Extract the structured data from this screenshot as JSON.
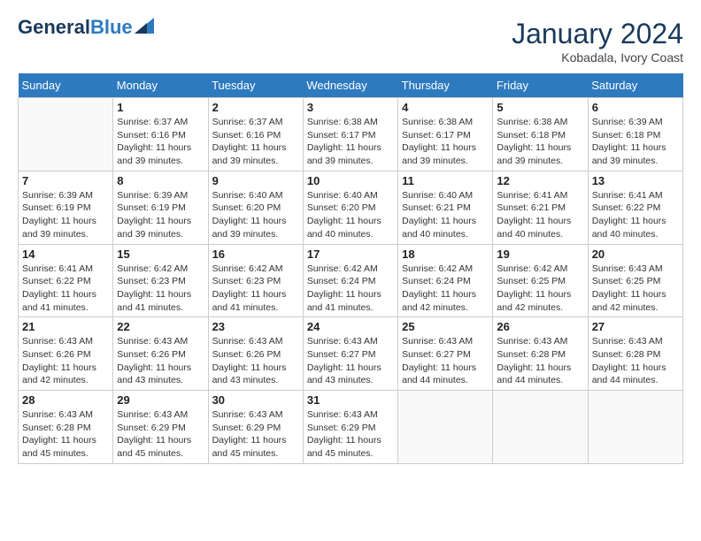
{
  "logo": {
    "general": "General",
    "blue": "Blue"
  },
  "title": {
    "month_year": "January 2024",
    "location": "Kobadala, Ivory Coast"
  },
  "days_of_week": [
    "Sunday",
    "Monday",
    "Tuesday",
    "Wednesday",
    "Thursday",
    "Friday",
    "Saturday"
  ],
  "weeks": [
    [
      {
        "day": "",
        "sunrise": "",
        "sunset": "",
        "daylight": ""
      },
      {
        "day": "1",
        "sunrise": "Sunrise: 6:37 AM",
        "sunset": "Sunset: 6:16 PM",
        "daylight": "Daylight: 11 hours and 39 minutes."
      },
      {
        "day": "2",
        "sunrise": "Sunrise: 6:37 AM",
        "sunset": "Sunset: 6:16 PM",
        "daylight": "Daylight: 11 hours and 39 minutes."
      },
      {
        "day": "3",
        "sunrise": "Sunrise: 6:38 AM",
        "sunset": "Sunset: 6:17 PM",
        "daylight": "Daylight: 11 hours and 39 minutes."
      },
      {
        "day": "4",
        "sunrise": "Sunrise: 6:38 AM",
        "sunset": "Sunset: 6:17 PM",
        "daylight": "Daylight: 11 hours and 39 minutes."
      },
      {
        "day": "5",
        "sunrise": "Sunrise: 6:38 AM",
        "sunset": "Sunset: 6:18 PM",
        "daylight": "Daylight: 11 hours and 39 minutes."
      },
      {
        "day": "6",
        "sunrise": "Sunrise: 6:39 AM",
        "sunset": "Sunset: 6:18 PM",
        "daylight": "Daylight: 11 hours and 39 minutes."
      }
    ],
    [
      {
        "day": "7",
        "sunrise": "Sunrise: 6:39 AM",
        "sunset": "Sunset: 6:19 PM",
        "daylight": "Daylight: 11 hours and 39 minutes."
      },
      {
        "day": "8",
        "sunrise": "Sunrise: 6:39 AM",
        "sunset": "Sunset: 6:19 PM",
        "daylight": "Daylight: 11 hours and 39 minutes."
      },
      {
        "day": "9",
        "sunrise": "Sunrise: 6:40 AM",
        "sunset": "Sunset: 6:20 PM",
        "daylight": "Daylight: 11 hours and 39 minutes."
      },
      {
        "day": "10",
        "sunrise": "Sunrise: 6:40 AM",
        "sunset": "Sunset: 6:20 PM",
        "daylight": "Daylight: 11 hours and 40 minutes."
      },
      {
        "day": "11",
        "sunrise": "Sunrise: 6:40 AM",
        "sunset": "Sunset: 6:21 PM",
        "daylight": "Daylight: 11 hours and 40 minutes."
      },
      {
        "day": "12",
        "sunrise": "Sunrise: 6:41 AM",
        "sunset": "Sunset: 6:21 PM",
        "daylight": "Daylight: 11 hours and 40 minutes."
      },
      {
        "day": "13",
        "sunrise": "Sunrise: 6:41 AM",
        "sunset": "Sunset: 6:22 PM",
        "daylight": "Daylight: 11 hours and 40 minutes."
      }
    ],
    [
      {
        "day": "14",
        "sunrise": "Sunrise: 6:41 AM",
        "sunset": "Sunset: 6:22 PM",
        "daylight": "Daylight: 11 hours and 41 minutes."
      },
      {
        "day": "15",
        "sunrise": "Sunrise: 6:42 AM",
        "sunset": "Sunset: 6:23 PM",
        "daylight": "Daylight: 11 hours and 41 minutes."
      },
      {
        "day": "16",
        "sunrise": "Sunrise: 6:42 AM",
        "sunset": "Sunset: 6:23 PM",
        "daylight": "Daylight: 11 hours and 41 minutes."
      },
      {
        "day": "17",
        "sunrise": "Sunrise: 6:42 AM",
        "sunset": "Sunset: 6:24 PM",
        "daylight": "Daylight: 11 hours and 41 minutes."
      },
      {
        "day": "18",
        "sunrise": "Sunrise: 6:42 AM",
        "sunset": "Sunset: 6:24 PM",
        "daylight": "Daylight: 11 hours and 42 minutes."
      },
      {
        "day": "19",
        "sunrise": "Sunrise: 6:42 AM",
        "sunset": "Sunset: 6:25 PM",
        "daylight": "Daylight: 11 hours and 42 minutes."
      },
      {
        "day": "20",
        "sunrise": "Sunrise: 6:43 AM",
        "sunset": "Sunset: 6:25 PM",
        "daylight": "Daylight: 11 hours and 42 minutes."
      }
    ],
    [
      {
        "day": "21",
        "sunrise": "Sunrise: 6:43 AM",
        "sunset": "Sunset: 6:26 PM",
        "daylight": "Daylight: 11 hours and 42 minutes."
      },
      {
        "day": "22",
        "sunrise": "Sunrise: 6:43 AM",
        "sunset": "Sunset: 6:26 PM",
        "daylight": "Daylight: 11 hours and 43 minutes."
      },
      {
        "day": "23",
        "sunrise": "Sunrise: 6:43 AM",
        "sunset": "Sunset: 6:26 PM",
        "daylight": "Daylight: 11 hours and 43 minutes."
      },
      {
        "day": "24",
        "sunrise": "Sunrise: 6:43 AM",
        "sunset": "Sunset: 6:27 PM",
        "daylight": "Daylight: 11 hours and 43 minutes."
      },
      {
        "day": "25",
        "sunrise": "Sunrise: 6:43 AM",
        "sunset": "Sunset: 6:27 PM",
        "daylight": "Daylight: 11 hours and 44 minutes."
      },
      {
        "day": "26",
        "sunrise": "Sunrise: 6:43 AM",
        "sunset": "Sunset: 6:28 PM",
        "daylight": "Daylight: 11 hours and 44 minutes."
      },
      {
        "day": "27",
        "sunrise": "Sunrise: 6:43 AM",
        "sunset": "Sunset: 6:28 PM",
        "daylight": "Daylight: 11 hours and 44 minutes."
      }
    ],
    [
      {
        "day": "28",
        "sunrise": "Sunrise: 6:43 AM",
        "sunset": "Sunset: 6:28 PM",
        "daylight": "Daylight: 11 hours and 45 minutes."
      },
      {
        "day": "29",
        "sunrise": "Sunrise: 6:43 AM",
        "sunset": "Sunset: 6:29 PM",
        "daylight": "Daylight: 11 hours and 45 minutes."
      },
      {
        "day": "30",
        "sunrise": "Sunrise: 6:43 AM",
        "sunset": "Sunset: 6:29 PM",
        "daylight": "Daylight: 11 hours and 45 minutes."
      },
      {
        "day": "31",
        "sunrise": "Sunrise: 6:43 AM",
        "sunset": "Sunset: 6:29 PM",
        "daylight": "Daylight: 11 hours and 45 minutes."
      },
      {
        "day": "",
        "sunrise": "",
        "sunset": "",
        "daylight": ""
      },
      {
        "day": "",
        "sunrise": "",
        "sunset": "",
        "daylight": ""
      },
      {
        "day": "",
        "sunrise": "",
        "sunset": "",
        "daylight": ""
      }
    ]
  ]
}
